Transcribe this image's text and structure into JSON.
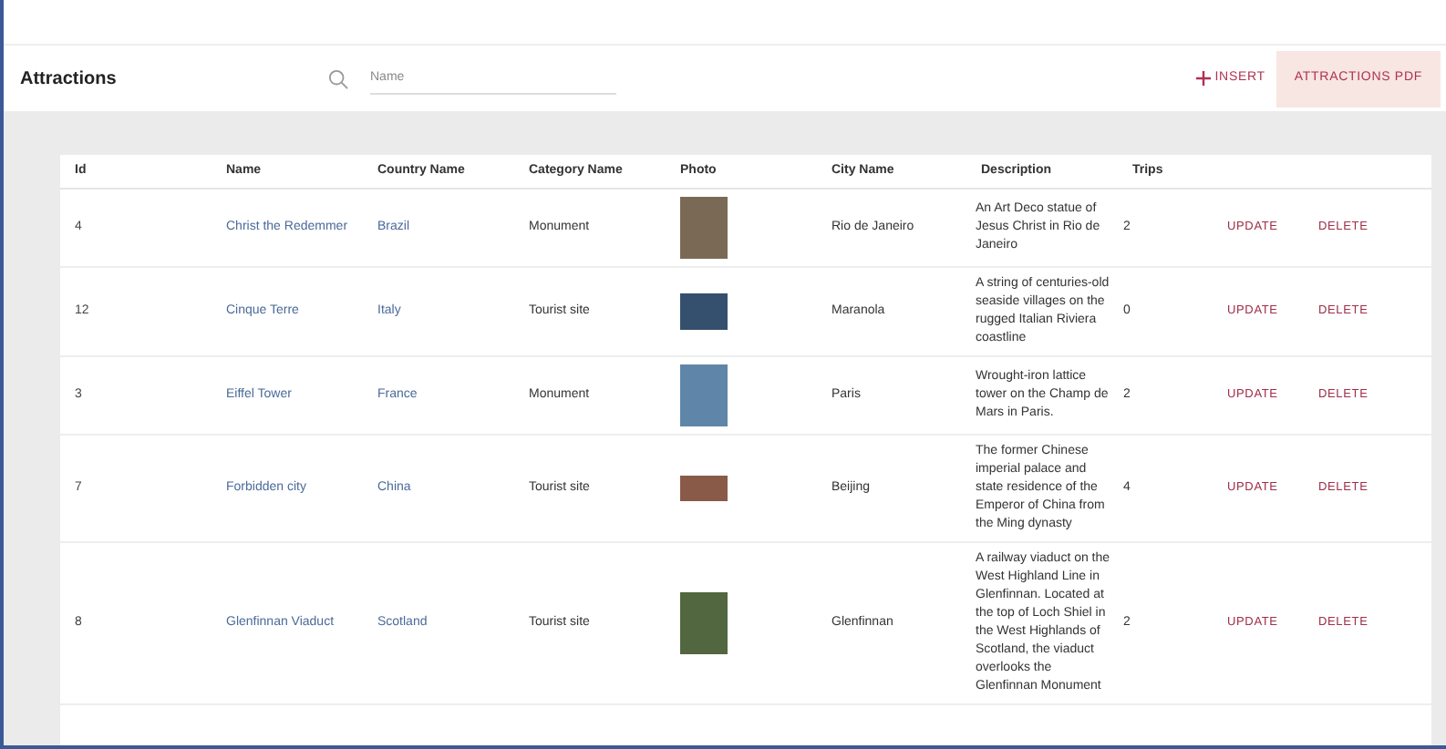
{
  "header": {
    "title": "Attractions",
    "search": {
      "placeholder": "Name"
    },
    "insert_button": "INSERT",
    "pdf_button": "ATTRACTIONS PDF"
  },
  "table": {
    "columns": [
      "Id",
      "Name",
      "Country Name",
      "Category Name",
      "Photo",
      "City Name",
      "Description",
      "Trips"
    ],
    "rows": [
      {
        "id": "4",
        "name": "Christ the Redemmer",
        "country": "Brazil",
        "category": "Monument",
        "photo": {
          "kind": "portrait"
        },
        "city": "Rio de Janeiro",
        "description": "An Art Deco statue of Jesus Christ in Rio de Janeiro",
        "trips": "2",
        "update": "UPDATE",
        "delete": "DELETE"
      },
      {
        "id": "12",
        "name": "Cinque Terre",
        "country": "Italy",
        "category": "Tourist site",
        "photo": {
          "kind": "landscape"
        },
        "city": "Maranola",
        "description": "A string of centuries-old seaside villages on the rugged Italian Riviera coastline",
        "trips": "0",
        "update": "UPDATE",
        "delete": "DELETE"
      },
      {
        "id": "3",
        "name": "Eiffel Tower",
        "country": "France",
        "category": "Monument",
        "photo": {
          "kind": "portrait"
        },
        "city": "Paris",
        "description": "Wrought-iron lattice tower on the Champ de Mars in Paris.",
        "trips": "2",
        "update": "UPDATE",
        "delete": "DELETE"
      },
      {
        "id": "7",
        "name": "Forbidden city",
        "country": "China",
        "category": "Tourist site",
        "photo": {
          "kind": "panorama"
        },
        "city": "Beijing",
        "description": "The former Chinese imperial palace and state residence of the Emperor of China from the Ming dynasty",
        "trips": "4",
        "update": "UPDATE",
        "delete": "DELETE"
      },
      {
        "id": "8",
        "name": "Glenfinnan Viaduct",
        "country": "Scotland",
        "category": "Tourist site",
        "photo": {
          "kind": "portrait"
        },
        "city": "Glenfinnan",
        "description": "A railway viaduct on the West Highland Line in Glenfinnan. Located at the top of Loch Shiel in the West Highlands of Scotland, the viaduct overlooks the Glenfinnan Monument",
        "trips": "2",
        "update": "UPDATE",
        "delete": "DELETE"
      }
    ]
  }
}
